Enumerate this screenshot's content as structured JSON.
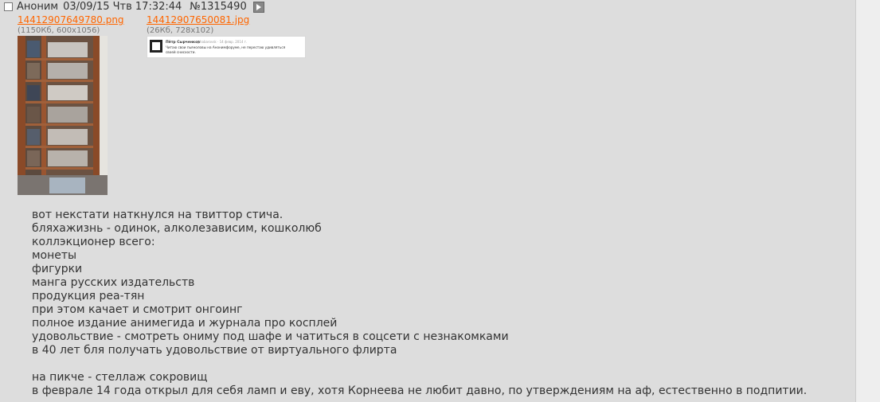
{
  "post": {
    "name": "Аноним",
    "date": "03/09/15 Чтв 17:32:44",
    "number": "№1315490"
  },
  "files": [
    {
      "name": "14412907649780.png",
      "meta": "(1150Кб, 600x1056)"
    },
    {
      "name": "14412907650081.jpg",
      "meta": "(26Кб, 728x102)"
    }
  ],
  "thumb2": {
    "author": "Пётр Сырченков",
    "handle": "@habarovsk · 14 февр. 2014 г.",
    "text1": "Читаю свои пьяноловы на Анонимфоруме, не перестаю удивляться",
    "text2": "своей снисхости."
  },
  "message": [
    "вот некстати наткнулся на твиттор стича.",
    "бляхажизнь - одинок, алколезависим, кошколюб",
    "коллэкционер всего:",
    "монеты",
    "фигурки",
    "манга русских издательств",
    "продукция реа-тян",
    "при этом качает и смотрит онгоинг",
    "полное издание анимегида и журнала про косплей",
    "удовольствие - смотреть ониму под шафе и чатиться в соцсети с незнакомками",
    "в 40 лет бля получать удовольствие от виртуального флирта",
    "",
    "на пикче - стеллаж сокровищ",
    "в феврале 14 года открыл для себя ламп и еву, хотя Корнеева не любит давно, по утверждениям на аф, естественно в подпитии."
  ]
}
